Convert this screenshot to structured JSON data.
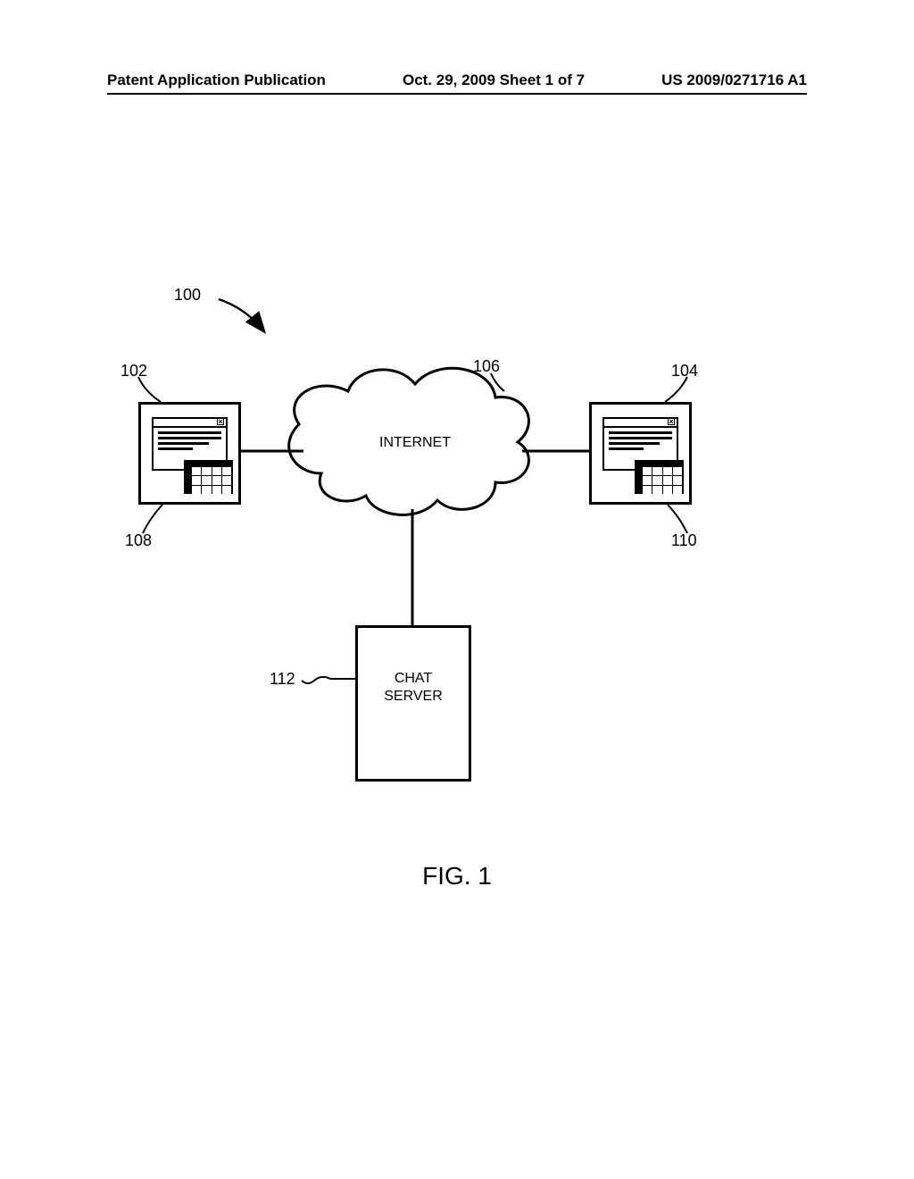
{
  "header": {
    "left": "Patent Application Publication",
    "center": "Oct. 29, 2009  Sheet 1 of 7",
    "right": "US 2009/0271716 A1"
  },
  "labels": {
    "ref100": "100",
    "ref102": "102",
    "ref104": "104",
    "ref106": "106",
    "ref108": "108",
    "ref110": "110",
    "ref112": "112"
  },
  "blocks": {
    "internet": "INTERNET",
    "chat_server": "CHAT\nSERVER"
  },
  "figure_caption": "FIG. 1"
}
